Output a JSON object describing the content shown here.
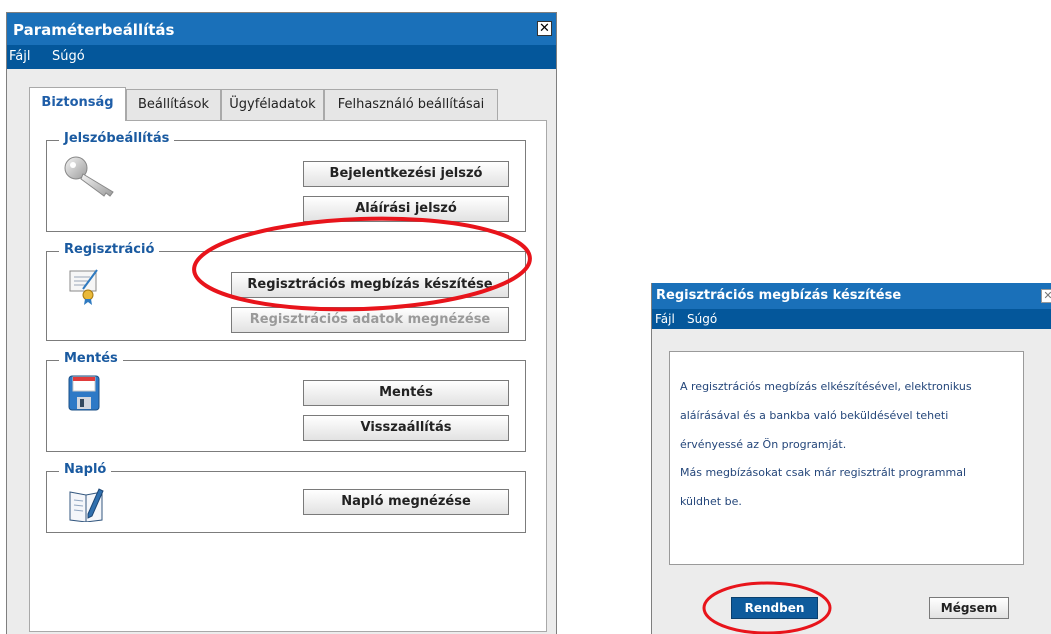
{
  "main_window": {
    "title": "Paraméterbeállítás",
    "close_glyph": "✕",
    "menu": [
      "Fájl",
      "Súgó"
    ],
    "tabs": [
      "Biztonság",
      "Beállítások",
      "Ügyféladatok",
      "Felhasználó beállításai"
    ],
    "active_tab": "Biztonság",
    "groups": {
      "password": {
        "title": "Jelszóbeállítás",
        "icon": "key-icon",
        "buttons": [
          "Bejelentkezési jelszó",
          "Aláírási jelszó"
        ]
      },
      "registration": {
        "title": "Regisztráció",
        "icon": "certificate-icon",
        "buttons": [
          "Regisztrációs megbízás készítése",
          "Regisztrációs adatok megnézése"
        ]
      },
      "backup": {
        "title": "Mentés",
        "icon": "floppy-disk-icon",
        "buttons": [
          "Mentés",
          "Visszaállítás"
        ]
      },
      "log": {
        "title": "Napló",
        "icon": "notebook-icon",
        "buttons": [
          "Napló megnézése"
        ]
      }
    }
  },
  "dialog": {
    "title": "Regisztrációs megbízás készítése",
    "menu": [
      "Fájl",
      "Súgó"
    ],
    "message_lines": [
      "A regisztrációs megbízás elkészítésével, elektronikus",
      "aláírásával és a bankba való beküldésével teheti",
      "érvényessé az Ön programját.",
      "Más megbízásokat csak már regisztrált programmal",
      "küldhet be."
    ],
    "ok_label": "Rendben",
    "cancel_label": "Mégsem"
  },
  "colors": {
    "title_bar": "#1a70b9",
    "menu_bar": "#04579b",
    "annotation": "#e8141b",
    "legend": "#1a5aa0"
  }
}
